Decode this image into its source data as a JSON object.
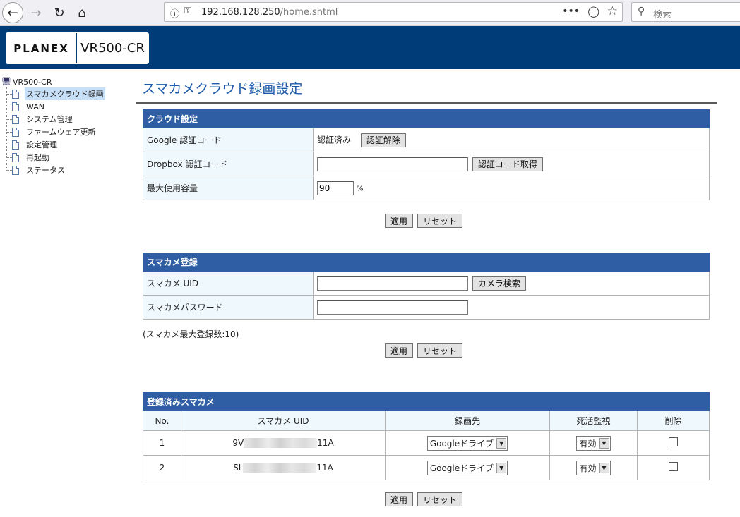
{
  "browser": {
    "url_host": "192.168.128.250",
    "url_path": "/home.shtml",
    "search_placeholder": "検索"
  },
  "header": {
    "logo": "PLANEX",
    "model": "VR500-CR"
  },
  "tree": {
    "root": "VR500-CR",
    "items": [
      {
        "label": "スマカメクラウド録画",
        "selected": true
      },
      {
        "label": "WAN",
        "selected": false
      },
      {
        "label": "システム管理",
        "selected": false
      },
      {
        "label": "ファームウェア更新",
        "selected": false
      },
      {
        "label": "設定管理",
        "selected": false
      },
      {
        "label": "再起動",
        "selected": false
      },
      {
        "label": "ステータス",
        "selected": false
      }
    ]
  },
  "page_title": "スマカメクラウド録画設定",
  "cloud": {
    "heading": "クラウド設定",
    "google_label": "Google 認証コード",
    "google_status": "認証済み",
    "google_button": "認証解除",
    "dropbox_label": "Dropbox 認証コード",
    "dropbox_value": "",
    "dropbox_button": "認証コード取得",
    "capacity_label": "最大使用容量",
    "capacity_value": "90",
    "capacity_unit": "%"
  },
  "camera": {
    "heading": "スマカメ登録",
    "uid_label": "スマカメ UID",
    "uid_value": "",
    "search_button": "カメラ検索",
    "password_label": "スマカメパスワード",
    "password_value": "",
    "note": "(スマカメ最大登録数:10)"
  },
  "registered": {
    "heading": "登録済みスマカメ",
    "columns": [
      "No.",
      "スマカメ UID",
      "録画先",
      "死活監視",
      "削除"
    ],
    "rows": [
      {
        "no": "1",
        "uid_prefix": "9V",
        "uid_suffix": "11A",
        "dest": "Googleドライブ",
        "monitor": "有効"
      },
      {
        "no": "2",
        "uid_prefix": "SL",
        "uid_suffix": "11A",
        "dest": "Googleドライブ",
        "monitor": "有効"
      }
    ]
  },
  "buttons": {
    "apply": "適用",
    "reset": "リセット"
  }
}
